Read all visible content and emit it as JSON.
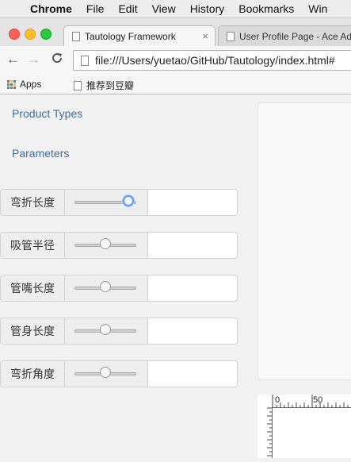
{
  "menubar": {
    "apple_glyph": "",
    "items": [
      "Chrome",
      "File",
      "Edit",
      "View",
      "History",
      "Bookmarks",
      "Win"
    ]
  },
  "tabs": [
    {
      "title": "Tautology Framework",
      "close": "×"
    },
    {
      "title": "User Profile Page - Ace Ad"
    }
  ],
  "toolbar": {
    "back": "←",
    "forward": "→",
    "reload": "C",
    "url": "file:///Users/yuetao/GitHub/Tautology/index.html#"
  },
  "bookmarks": [
    {
      "label": "Apps"
    },
    {
      "label": "推荐到豆瓣"
    }
  ],
  "nav": {
    "product_types": "Product Types",
    "parameters": "Parameters"
  },
  "params": [
    {
      "label": "弯折长度",
      "slider_level": 0.95,
      "focused": true
    },
    {
      "label": "吸管半径",
      "slider_level": 0.5,
      "focused": false
    },
    {
      "label": "管嘴长度",
      "slider_level": 0.5,
      "focused": false
    },
    {
      "label": "管身长度",
      "slider_level": 0.5,
      "focused": false
    },
    {
      "label": "弯折角度",
      "slider_level": 0.5,
      "focused": false
    }
  ],
  "ruler": {
    "tick_labels": [
      "0",
      "50"
    ]
  },
  "colors": {
    "link": "#3a6ea5",
    "focus_ring": "#5b9cf5",
    "apps_dots": [
      "#e8453c",
      "#f9bb2d",
      "#3b7ded",
      "#34a853",
      "#e8453c",
      "#f9bb2d",
      "#3b7ded",
      "#34a853",
      "#e8453c"
    ]
  }
}
